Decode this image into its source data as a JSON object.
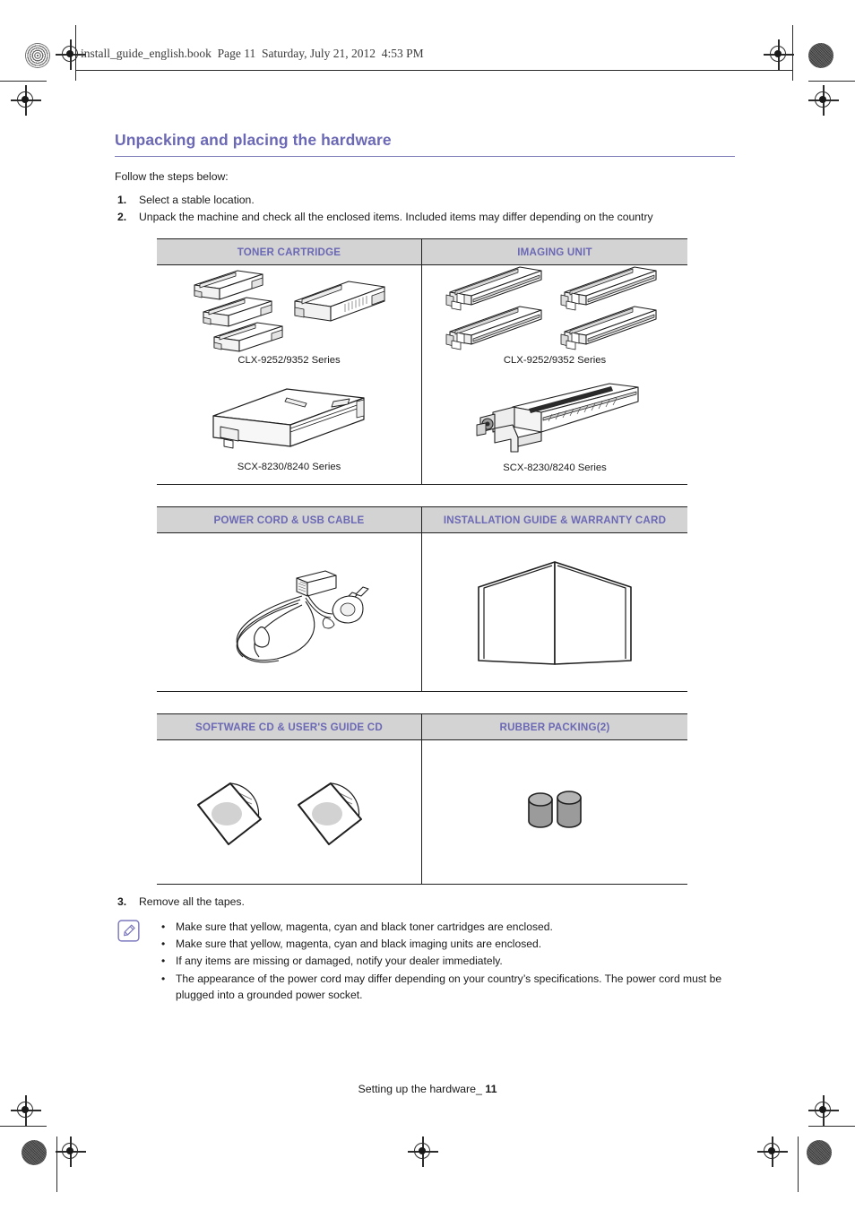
{
  "header": {
    "file_line": "install_guide_english.book  Page 11  Saturday, July 21, 2012  4:53 PM"
  },
  "section": {
    "title": "Unpacking and placing the hardware",
    "lead": "Follow the steps below:",
    "steps": [
      {
        "num": "1.",
        "text": "Select a stable location."
      },
      {
        "num": "2.",
        "text": "Unpack the machine and check all the enclosed items. Included items may differ depending on the country"
      },
      {
        "num": "3.",
        "text": "Remove all the tapes."
      }
    ]
  },
  "tables": [
    {
      "headers": [
        "TONER CARTRIDGE",
        "IMAGING UNIT"
      ],
      "cells": [
        {
          "figure": "toner-cartridge-group-clx",
          "caption": "CLX-9252/9352 Series"
        },
        {
          "figure": "imaging-unit-group-clx",
          "caption": "CLX-9252/9352 Series"
        },
        {
          "figure": "toner-cartridge-scx",
          "caption": "SCX-8230/8240 Series"
        },
        {
          "figure": "imaging-unit-scx",
          "caption": "SCX-8230/8240 Series"
        }
      ]
    },
    {
      "headers": [
        "POWER CORD & USB CABLE",
        "INSTALLATION GUIDE & WARRANTY CARD"
      ],
      "cells": [
        {
          "figure": "power-cord",
          "caption": ""
        },
        {
          "figure": "installation-guide-booklet",
          "caption": ""
        }
      ]
    },
    {
      "headers": [
        "SOFTWARE CD & USER'S GUIDE CD",
        "RUBBER PACKING(2)"
      ],
      "cells": [
        {
          "figure": "cd-sleeves",
          "caption": ""
        },
        {
          "figure": "rubber-packing",
          "caption": ""
        }
      ]
    }
  ],
  "note": {
    "icon": "note-pencil-icon",
    "bullets": [
      "Make sure that yellow, magenta, cyan and black toner cartridges are enclosed.",
      "Make sure that yellow, magenta, cyan and black imaging units are enclosed.",
      "If any items are missing or damaged, notify your dealer immediately.",
      "The appearance of the power cord may differ depending on your country’s specifications. The power cord must be plugged into a grounded power socket."
    ]
  },
  "footer": {
    "label": "Setting up the hardware_",
    "page": "11"
  },
  "colors": {
    "accent_purple": "#6b68b5",
    "header_fill": "#d3d3d3",
    "rule": "#1f1f1f"
  }
}
